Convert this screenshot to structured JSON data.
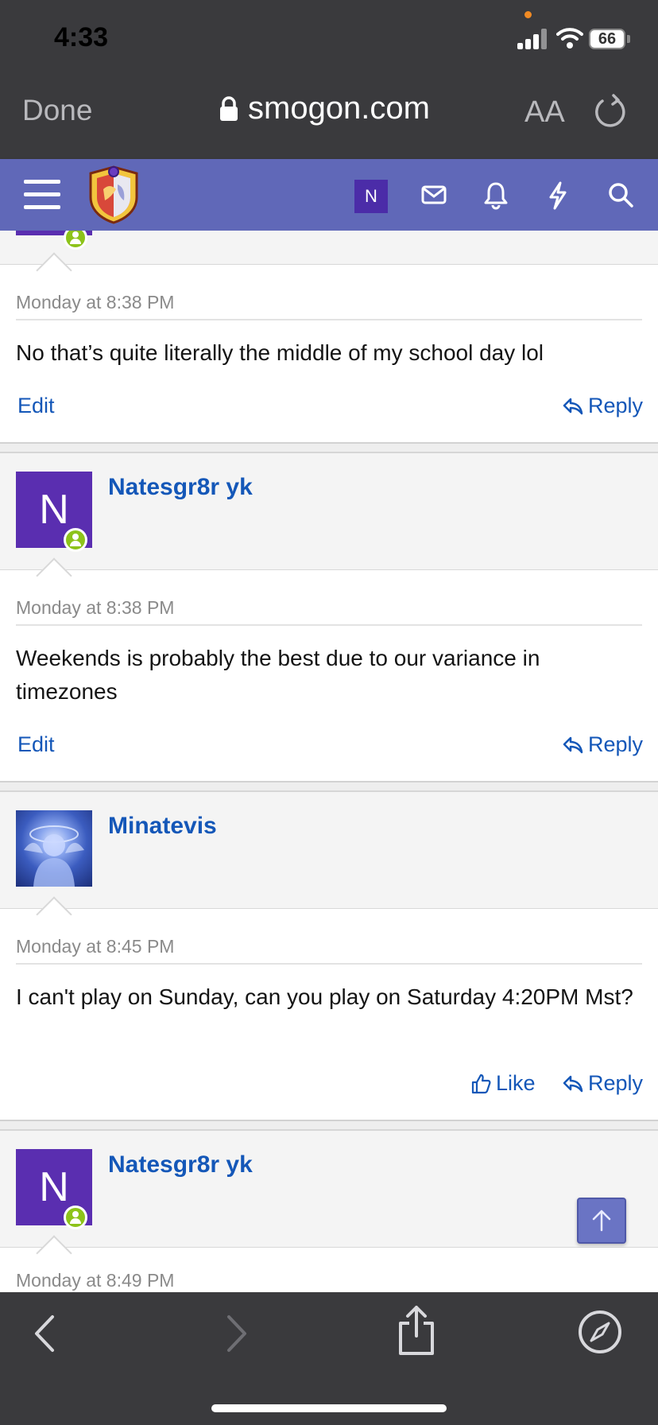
{
  "status_bar": {
    "time": "4:33",
    "battery": "66"
  },
  "browser": {
    "done_label": "Done",
    "url": "smogon.com",
    "text_size_label": "AA"
  },
  "header": {
    "user_initial": "N"
  },
  "posts": [
    {
      "date": "Monday at 8:38 PM",
      "message": "No that’s quite literally the middle of my school day lol",
      "left_action": "Edit",
      "reply_label": "Reply"
    },
    {
      "author": "Natesgr8r yk",
      "avatar_initial": "N",
      "date": "Monday at 8:38 PM",
      "message": "Weekends is probably the best due to our variance in timezones",
      "left_action": "Edit",
      "reply_label": "Reply"
    },
    {
      "author": "Minatevis",
      "date": "Monday at 8:45 PM",
      "message": "I can't play on Sunday, can you play on Saturday 4:20PM Mst?",
      "like_label": "Like",
      "reply_label": "Reply"
    },
    {
      "author": "Natesgr8r yk",
      "avatar_initial": "N",
      "date": "Monday at 8:49 PM"
    }
  ],
  "colors": {
    "header": "#6068b8",
    "link": "#1457b8",
    "chrome": "#3a3a3d",
    "avatar": "#5a2eb0",
    "online": "#8dc31a"
  }
}
